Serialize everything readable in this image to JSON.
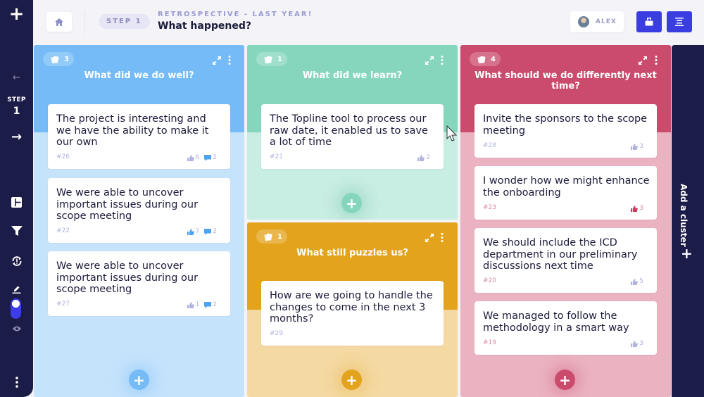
{
  "rail": {
    "add_icon": "plus-icon",
    "prev_icon": "arrow-left-icon",
    "step_label": "STEP",
    "step_number": "1",
    "next_icon": "arrow-right-icon",
    "tools": [
      "board-layout-icon",
      "filter-icon",
      "sync-alert-icon",
      "edit-icon",
      "toggle",
      "eye-icon"
    ],
    "more_icon": "more-vertical-icon"
  },
  "header": {
    "home_icon": "home-icon",
    "step_pill": "STEP 1",
    "subtitle": "RETROSPECTIVE - LAST YEAR!",
    "title": "What happened?",
    "user_name": "ALEX",
    "action_icons": [
      "open-folder-icon",
      "list-icon"
    ]
  },
  "colors": {
    "blue": "#74bbf7",
    "blue_light": "#c6e3fc",
    "green": "#85d6bd",
    "green_light": "#c8ede2",
    "orange": "#e3a31c",
    "orange_light": "#f4d9a2",
    "pink": "#cb4b6c",
    "pink_light": "#ebb3c1",
    "navy": "#1c1c48",
    "accent": "#3a3de0"
  },
  "columns": [
    {
      "title": "What did we do well?",
      "count": "3",
      "cards": [
        {
          "text": "The project is interesting and we have the ability to make it our own",
          "id": "#26",
          "likes": "6",
          "comments": "2"
        },
        {
          "text": "We were able to uncover important issues during our scope meeting",
          "id": "#22",
          "likes": "7",
          "comments": "2",
          "liked": true
        },
        {
          "text": "We were able to uncover important issues during our scope meeting",
          "id": "#27",
          "likes": "1",
          "comments": "2"
        }
      ]
    },
    {
      "title": "What did we learn?",
      "count": "1",
      "cards": [
        {
          "text": "The Topline tool to process our raw date, it enabled us to save a lot of time",
          "id": "#21",
          "likes": "2"
        }
      ]
    },
    {
      "title": "What still puzzles us?",
      "count": "1",
      "cards": [
        {
          "text": "How are we going to handle the changes to come in the next 3 months?",
          "id": "#29"
        }
      ]
    },
    {
      "title": "What should we do differently next time?",
      "count": "4",
      "cards": [
        {
          "text": "Invite the sponsors to the scope meeting",
          "id": "#28",
          "likes": "3"
        },
        {
          "text": "I wonder how we might enhance the onboarding",
          "id": "#23",
          "likes": "3",
          "liked": true
        },
        {
          "text": "We should include the ICD department in our preliminary discussions next time",
          "id": "#20",
          "likes": "5"
        },
        {
          "text": "We managed to follow the methodology in a smart way",
          "id": "#19",
          "likes": "3"
        }
      ]
    }
  ],
  "cluster": {
    "label": "Add a cluster",
    "icon": "plus-icon"
  }
}
